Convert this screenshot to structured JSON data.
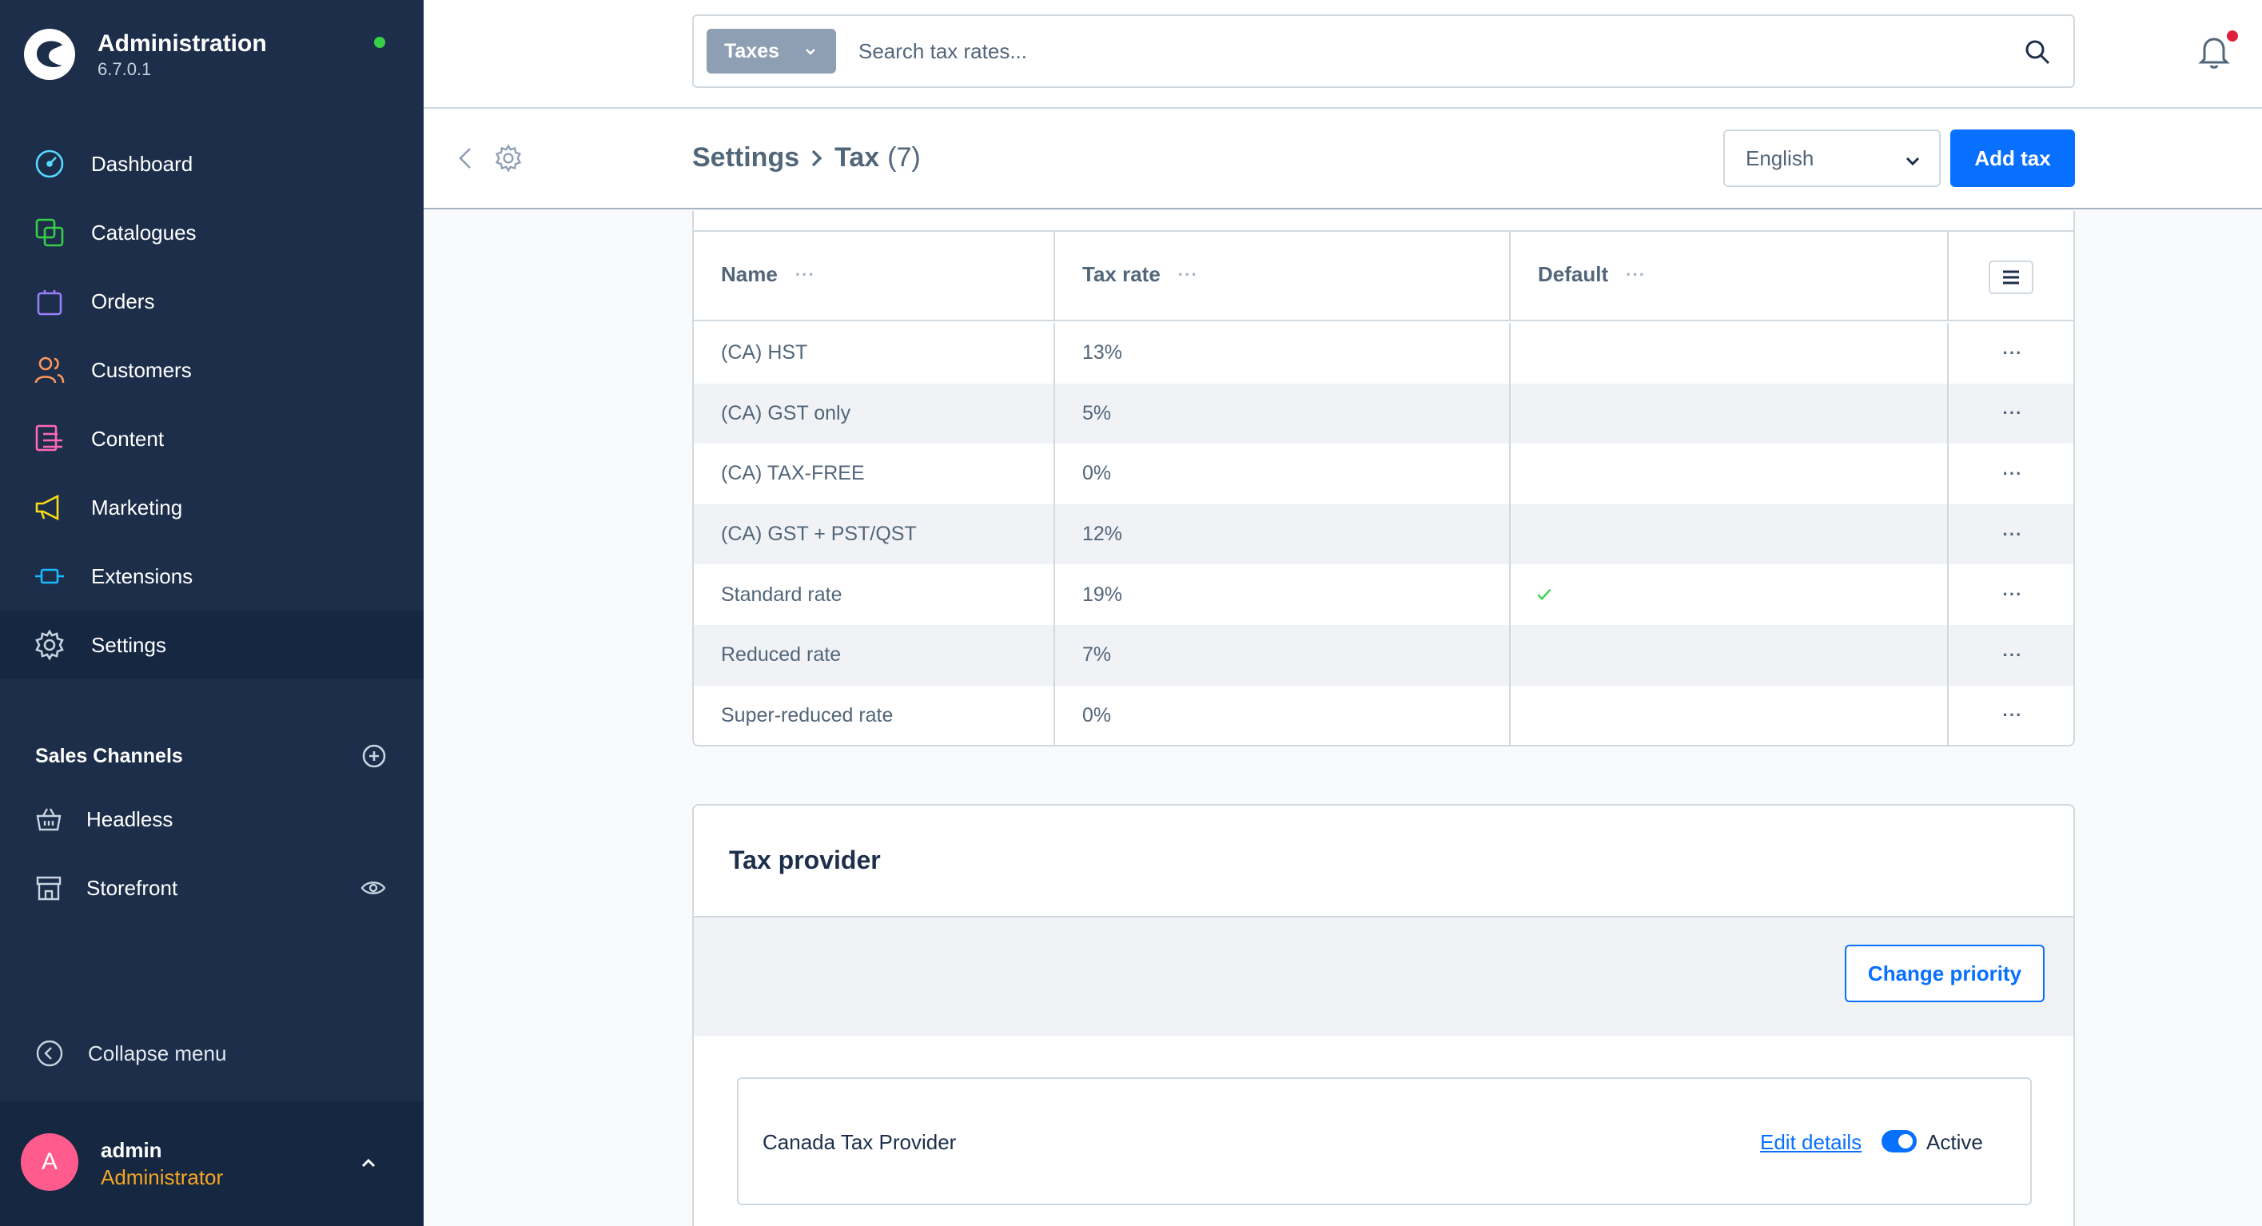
{
  "app": {
    "title": "Administration",
    "version": "6.7.0.1"
  },
  "nav": {
    "items": [
      {
        "label": "Dashboard"
      },
      {
        "label": "Catalogues"
      },
      {
        "label": "Orders"
      },
      {
        "label": "Customers"
      },
      {
        "label": "Content"
      },
      {
        "label": "Marketing"
      },
      {
        "label": "Extensions"
      },
      {
        "label": "Settings"
      }
    ],
    "active_index": 7,
    "icon_colors": [
      "#57d9ff",
      "#37d046",
      "#9a7ff8",
      "#ff9758",
      "#ff68b4",
      "#fadb14",
      "#1ab9ff",
      "#c9d3df"
    ]
  },
  "sales_channels": {
    "title": "Sales Channels",
    "items": [
      {
        "label": "Headless"
      },
      {
        "label": "Storefront"
      }
    ]
  },
  "collapse_label": "Collapse menu",
  "user": {
    "initial": "A",
    "name": "admin",
    "role": "Administrator"
  },
  "search": {
    "type_label": "Taxes",
    "placeholder": "Search tax rates..."
  },
  "breadcrumb": {
    "section": "Settings",
    "page": "Tax",
    "count": "(7)"
  },
  "language": {
    "selected": "English"
  },
  "add_button": "Add tax",
  "grid": {
    "columns": [
      "Name",
      "Tax rate",
      "Default"
    ],
    "column_menu": "···",
    "row_menu": "···",
    "rows": [
      {
        "name": "(CA) HST",
        "rate": "13%",
        "default": false
      },
      {
        "name": "(CA) GST only",
        "rate": "5%",
        "default": false
      },
      {
        "name": "(CA) TAX-FREE",
        "rate": "0%",
        "default": false
      },
      {
        "name": "(CA) GST + PST/QST",
        "rate": "12%",
        "default": false
      },
      {
        "name": "Standard rate",
        "rate": "19%",
        "default": true
      },
      {
        "name": "Reduced rate",
        "rate": "7%",
        "default": false
      },
      {
        "name": "Super-reduced rate",
        "rate": "0%",
        "default": false
      }
    ]
  },
  "tax_provider": {
    "title": "Tax provider",
    "change_priority": "Change priority",
    "providers": [
      {
        "name": "Canada Tax Provider",
        "edit_label": "Edit details",
        "active_label": "Active",
        "active": true
      }
    ]
  },
  "colors": {
    "accent": "#0870ff",
    "sidebar": "#1c2e4a",
    "success": "#37d046",
    "avatar": "#ff5c8d",
    "role": "#f5a623"
  }
}
